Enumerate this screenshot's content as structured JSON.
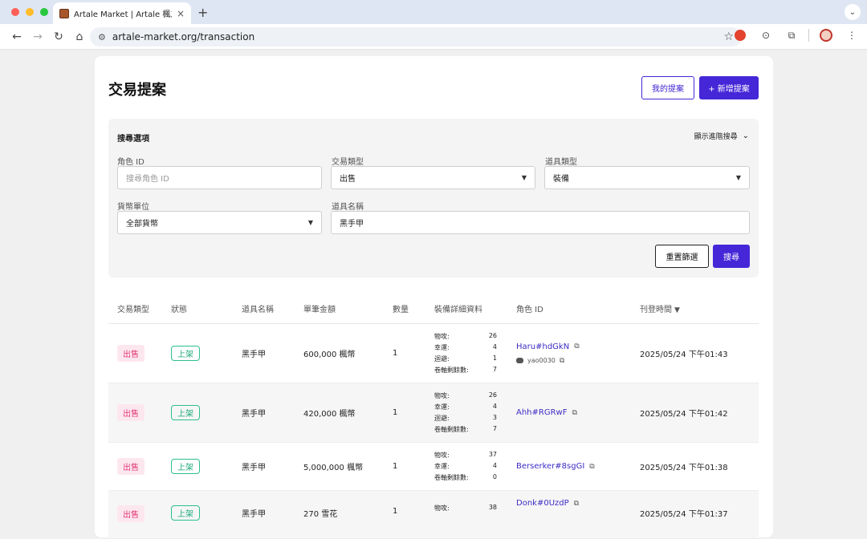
{
  "browser": {
    "tab_title": "Artale Market | Artale 楓之谷物",
    "tab_close": "×",
    "new_tab": "+",
    "url": "artale-market.org/transaction"
  },
  "page": {
    "title": "交易提案",
    "my_proposals_label": "我的提案",
    "new_proposal_label": "+ 新增提案"
  },
  "search": {
    "title": "搜尋選項",
    "advanced_label": "顯示進階搜尋",
    "character_id_label": "角色 ID",
    "character_id_placeholder": "搜尋角色 ID",
    "trade_type_label": "交易類型",
    "trade_type_value": "出售",
    "item_type_label": "道具類型",
    "item_type_value": "裝備",
    "currency_label": "貨幣單位",
    "currency_value": "全部貨幣",
    "item_name_label": "道具名稱",
    "item_name_value": "黑手甲",
    "reset_label": "重置篩選",
    "search_label": "搜尋"
  },
  "table": {
    "headers": {
      "trade_type": "交易類型",
      "status": "狀態",
      "item_name": "道具名稱",
      "unit_price": "單筆金額",
      "quantity": "數量",
      "equipment_details": "裝備詳細資料",
      "character_id": "角色 ID",
      "posted_time": "刊登時間",
      "sort_arrow": "▼"
    },
    "rows": [
      {
        "trade_type": "出售",
        "status": "上架",
        "item_name": "黑手甲",
        "price": "600,000 楓幣",
        "quantity": "1",
        "stats": [
          {
            "label": "物攻:",
            "value": "26"
          },
          {
            "label": "幸運:",
            "value": "4"
          },
          {
            "label": "迴避:",
            "value": "1"
          },
          {
            "label": "卷軸剩餘數:",
            "value": "7"
          }
        ],
        "character": "Haru#hdGkN",
        "discord": "yao0030",
        "time": "2025/05/24 下午01:43"
      },
      {
        "trade_type": "出售",
        "status": "上架",
        "item_name": "黑手甲",
        "price": "420,000 楓幣",
        "quantity": "1",
        "stats": [
          {
            "label": "物攻:",
            "value": "26"
          },
          {
            "label": "幸運:",
            "value": "4"
          },
          {
            "label": "迴避:",
            "value": "3"
          },
          {
            "label": "卷軸剩餘數:",
            "value": "7"
          }
        ],
        "character": "Ahh#RGRwF",
        "discord": "",
        "time": "2025/05/24 下午01:42"
      },
      {
        "trade_type": "出售",
        "status": "上架",
        "item_name": "黑手甲",
        "price": "5,000,000 楓幣",
        "quantity": "1",
        "stats": [
          {
            "label": "物攻:",
            "value": "37"
          },
          {
            "label": "幸運:",
            "value": "4"
          },
          {
            "label": "卷軸剩餘數:",
            "value": "0"
          }
        ],
        "character": "Berserker#8sgGI",
        "discord": "",
        "time": "2025/05/24 下午01:38"
      },
      {
        "trade_type": "出售",
        "status": "上架",
        "item_name": "黑手甲",
        "price": "270 雪花",
        "quantity": "1",
        "stats": [
          {
            "label": "物攻:",
            "value": "38"
          }
        ],
        "character": "Donk#0UzdP",
        "discord": "",
        "time": "2025/05/24 下午01:37"
      }
    ]
  },
  "colors": {
    "accent": "#4527d8",
    "sell_badge": "#e23b78",
    "listed_badge": "#1aa77a",
    "link": "#3d2bc4"
  }
}
